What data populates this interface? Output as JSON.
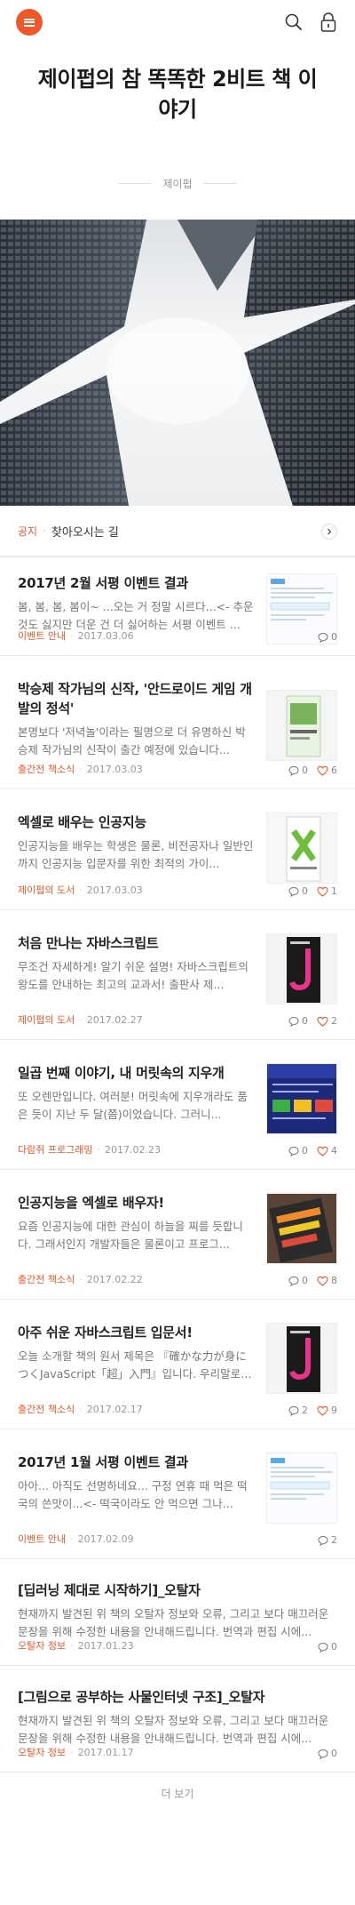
{
  "header": {
    "title": "제이펍의 참 똑똑한 2비트 책 이야기",
    "author": "제이펍"
  },
  "icons": {
    "menu": "menu-icon",
    "search": "search-icon",
    "lock": "lock-icon",
    "comment": "comment-icon",
    "heart": "heart-icon",
    "chevron": "chevron-right-icon"
  },
  "colors": {
    "accent": "#f0572a"
  },
  "notice": {
    "tag": "공지",
    "text": "찾아오시는 길"
  },
  "posts": [
    {
      "title": "2017년 2월 서평 이벤트 결과",
      "excerpt": "봄, 봄, 봄, 봄이~ ...오는 거 정말 시르다...<- 추운 것도 싫지만 더운 건 더 싫어하는 서평 이벤트 ...",
      "category": "이벤트 안내",
      "date": "2017.03.06",
      "comments": "0",
      "likes": ""
    },
    {
      "title": "박승제 작가님의 신작, '안드로이드 게임 개발의 정석'",
      "excerpt": "본명보다 '저녁놀'이라는 필명으로 더 유명하신 박승제 작가님의 신작이 출간 예정에 있습니다...",
      "category": "출간전 책소식",
      "date": "2017.03.03",
      "comments": "0",
      "likes": "6"
    },
    {
      "title": "엑셀로 배우는 인공지능",
      "excerpt": "인공지능을 배우는 학생은 물론, 비전공자나 일반인까지 인공지능 입문자를 위한 최적의 가이...",
      "category": "제이펍의 도서",
      "date": "2017.03.03",
      "comments": "0",
      "likes": "1"
    },
    {
      "title": "처음 만나는 자바스크립트",
      "excerpt": "무조건 자세하게! 알기 쉬운 설명! 자바스크립트의 왕도를 안내하는 최고의 교과서! 출판사 제...",
      "category": "제이펍의 도서",
      "date": "2017.02.27",
      "comments": "0",
      "likes": "2"
    },
    {
      "title": "일곱 번째 이야기, 내 머릿속의 지우개",
      "excerpt": "또 오렌만입니다. 여러분! 머릿속에 지우개라도 품은 듯이 지난 두 달(쯤)이었습니다. 그러니...",
      "category": "다람쥐 프로그래밍",
      "date": "2017.02.23",
      "comments": "0",
      "likes": "4"
    },
    {
      "title": "인공지능을 엑셀로 배우자!",
      "excerpt": "요즘 인공지능에 대한 관심이 하늘을 찌를 듯합니다. 그래서인지 개발자들은 물론이고 프로그...",
      "category": "출간전 책소식",
      "date": "2017.02.22",
      "comments": "0",
      "likes": "8"
    },
    {
      "title": "아주 쉬운 자바스크립트 입문서!",
      "excerpt": "오늘 소개할 책의 원서 제목은 『確かな力が身につくJavaScript「超」入門』입니다. 우리말로 바...",
      "category": "출간전 책소식",
      "date": "2017.02.17",
      "comments": "2",
      "likes": "9"
    },
    {
      "title": "2017년 1월 서평 이벤트 결과",
      "excerpt": "아아... 아직도 선명하네요... 구정 연휴 때 먹은 떡국의 쓴맛이...<- 떡국이라도 안 먹으면 그나...",
      "category": "이벤트 안내",
      "date": "2017.02.09",
      "comments": "2",
      "likes": ""
    },
    {
      "title": "[딥러닝 제대로 시작하기]_오탈자",
      "excerpt": "현재까지 발견된 위 책의 오탈자 정보와 오류, 그리고 보다 매끄러운 문장을 위해 수정한 내용을 안내해드립니다. 번역과 편집 시에...",
      "category": "오탈자 정보",
      "date": "2017.01.23",
      "comments": "0",
      "likes": ""
    },
    {
      "title": "[그림으로 공부하는 사물인터넷 구조]_오탈자",
      "excerpt": "현재까지 발견된 위 책의 오탈자 정보와 오류, 그리고 보다 매끄러운 문장을 위해 수정한 내용을 안내해드립니다. 번역과 편집 시에...",
      "category": "오탈자 정보",
      "date": "2017.01.17",
      "comments": "0",
      "likes": ""
    }
  ],
  "more": {
    "label": "더 보기"
  }
}
